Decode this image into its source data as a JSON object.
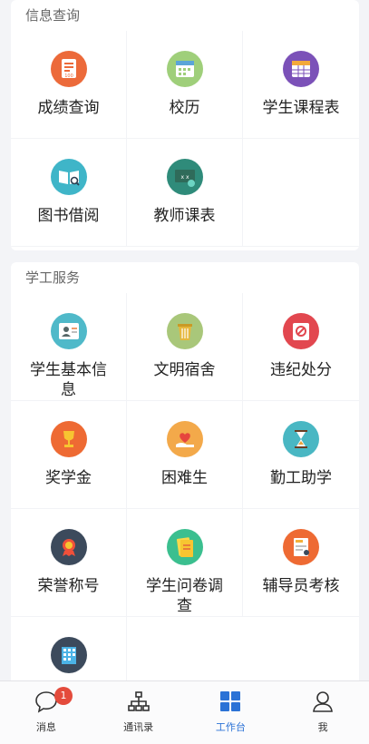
{
  "sections": {
    "info": {
      "title": "信息查询",
      "items": [
        {
          "label": "成绩查询",
          "icon": "score-report-icon"
        },
        {
          "label": "校历",
          "icon": "calendar-icon"
        },
        {
          "label": "学生课程表",
          "icon": "timetable-icon"
        },
        {
          "label": "图书借阅",
          "icon": "book-search-icon"
        },
        {
          "label": "教师课表",
          "icon": "teacher-board-icon"
        }
      ]
    },
    "student": {
      "title": "学工服务",
      "items": [
        {
          "label": "学生基本信息",
          "icon": "student-profile-icon"
        },
        {
          "label": "文明宿舍",
          "icon": "dorm-bin-icon"
        },
        {
          "label": "违纪处分",
          "icon": "violation-icon"
        },
        {
          "label": "奖学金",
          "icon": "trophy-icon"
        },
        {
          "label": "困难生",
          "icon": "helping-hand-icon"
        },
        {
          "label": "勤工助学",
          "icon": "hourglass-icon"
        },
        {
          "label": "荣誉称号",
          "icon": "medal-icon"
        },
        {
          "label": "学生问卷调查",
          "icon": "survey-icon"
        },
        {
          "label": "辅导员考核",
          "icon": "counselor-exam-icon"
        },
        {
          "label": "",
          "icon": "building-icon"
        }
      ]
    }
  },
  "tabbar": {
    "messages": {
      "label": "消息",
      "badge": "1"
    },
    "contacts": {
      "label": "通讯录"
    },
    "workbench": {
      "label": "工作台"
    },
    "me": {
      "label": "我"
    }
  },
  "colors": {
    "accent": "#2b72d6",
    "badge": "#e44b3c"
  }
}
